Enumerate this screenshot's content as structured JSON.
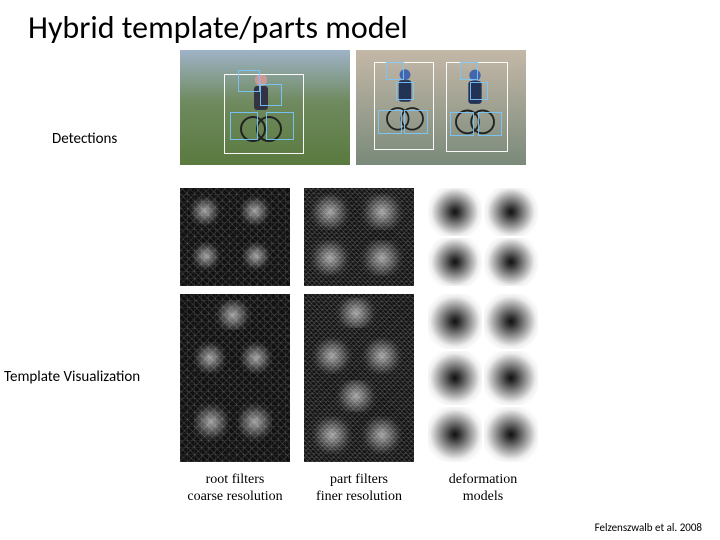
{
  "title": "Hybrid template/parts model",
  "labels": {
    "detections": "Detections",
    "template_visualization": "Template Visualization"
  },
  "columns": {
    "root": {
      "line1": "root filters",
      "line2": "coarse resolution"
    },
    "part": {
      "line1": "part filters",
      "line2": "finer resolution"
    },
    "deform": {
      "line1": "deformation",
      "line2": "models"
    }
  },
  "citation": "Felzenszwalb et al. 2008"
}
